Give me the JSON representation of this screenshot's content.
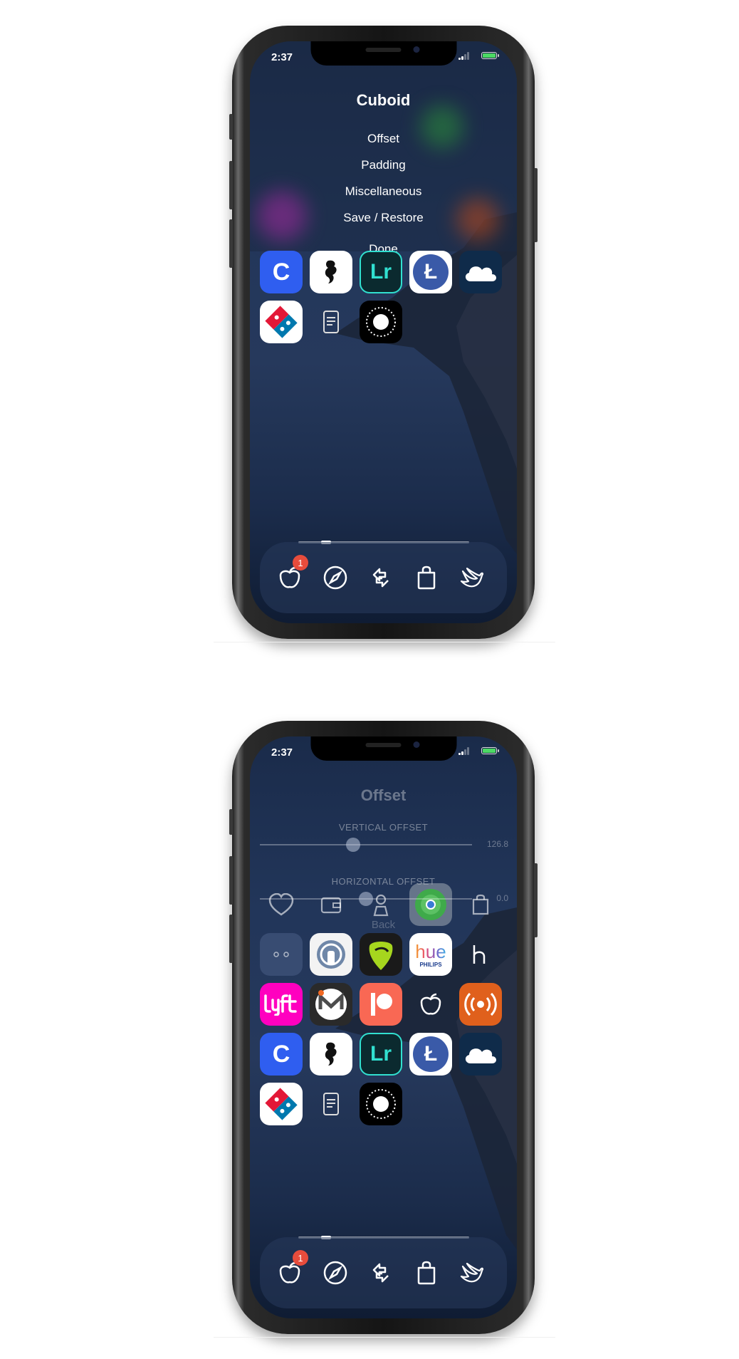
{
  "screen1": {
    "status_time": "2:37",
    "menu": {
      "title": "Cuboid",
      "items": [
        "Offset",
        "Padding",
        "Miscellaneous",
        "Save / Restore"
      ],
      "done_label": "Done"
    },
    "apps_row1": [
      {
        "icon": "c-app-icon",
        "letter": "C",
        "bg": "#2f5ef0"
      },
      {
        "icon": "seahorse-app-icon",
        "letter": "",
        "bg": "#ffffff"
      },
      {
        "icon": "lightroom-app-icon",
        "letter": "Lr",
        "bg": "#0b2a2f"
      },
      {
        "icon": "litecoin-app-icon",
        "letter": "Ł",
        "bg": "#ffffff"
      },
      {
        "icon": "cloud-app-icon",
        "letter": "",
        "bg": "#0f2b4a"
      }
    ],
    "apps_row2": [
      {
        "icon": "dominos-app-icon",
        "letter": "",
        "bg": "#ffffff"
      },
      {
        "icon": "phone-file-icon",
        "letter": "",
        "bg": "transparent"
      },
      {
        "icon": "record-app-icon",
        "letter": "",
        "bg": "#000000"
      }
    ],
    "dock": {
      "badge": "1"
    }
  },
  "screen2": {
    "status_time": "2:37",
    "offset_title": "Offset",
    "vertical_label": "VERTICAL OFFSET",
    "vertical_value": "126.8",
    "horizontal_label": "HORIZONTAL OFFSET",
    "horizontal_value": "0.0",
    "back_label": "Back",
    "vertical_fraction": 0.44,
    "horizontal_fraction": 0.5,
    "dock": {
      "badge": "1"
    }
  }
}
